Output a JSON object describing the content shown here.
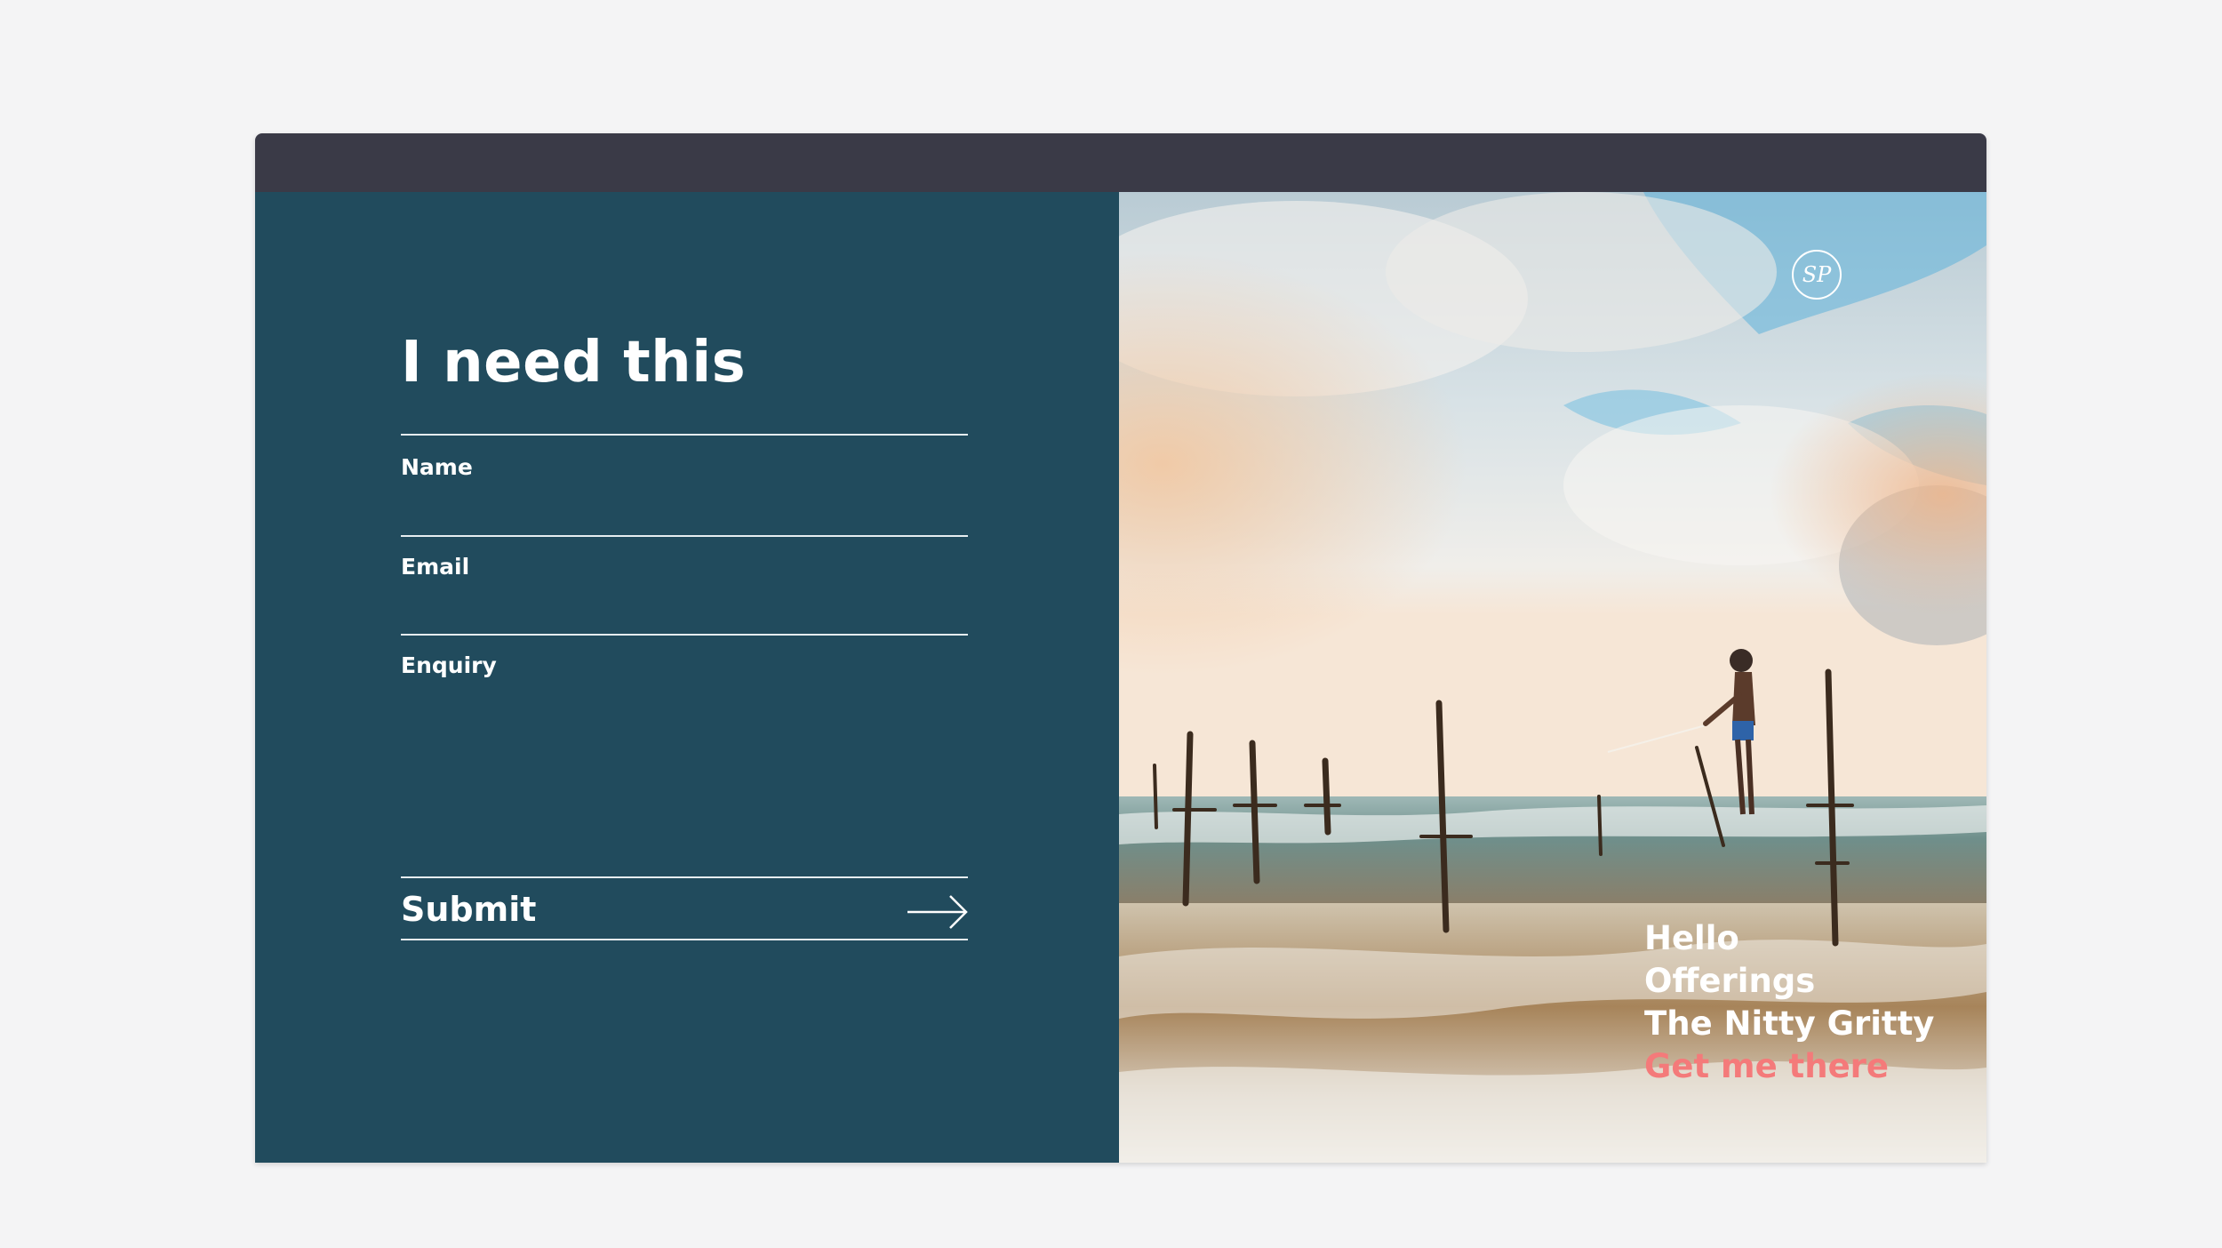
{
  "form": {
    "title": "I need this",
    "fields": [
      {
        "label": "Name",
        "value": ""
      },
      {
        "label": "Email",
        "value": ""
      },
      {
        "label": "Enquiry",
        "value": ""
      }
    ],
    "submit_label": "Submit"
  },
  "photo": {
    "logo_text": "SP",
    "nav": [
      {
        "label": "Hello"
      },
      {
        "label": "Offerings"
      },
      {
        "label": "The Nitty Gritty"
      },
      {
        "label": "Get me there"
      }
    ]
  },
  "colors": {
    "title_bar": "#3a3a47",
    "form_panel": "#214b5d",
    "accent": "#f47a7a",
    "page_background": "#f4f4f5"
  }
}
